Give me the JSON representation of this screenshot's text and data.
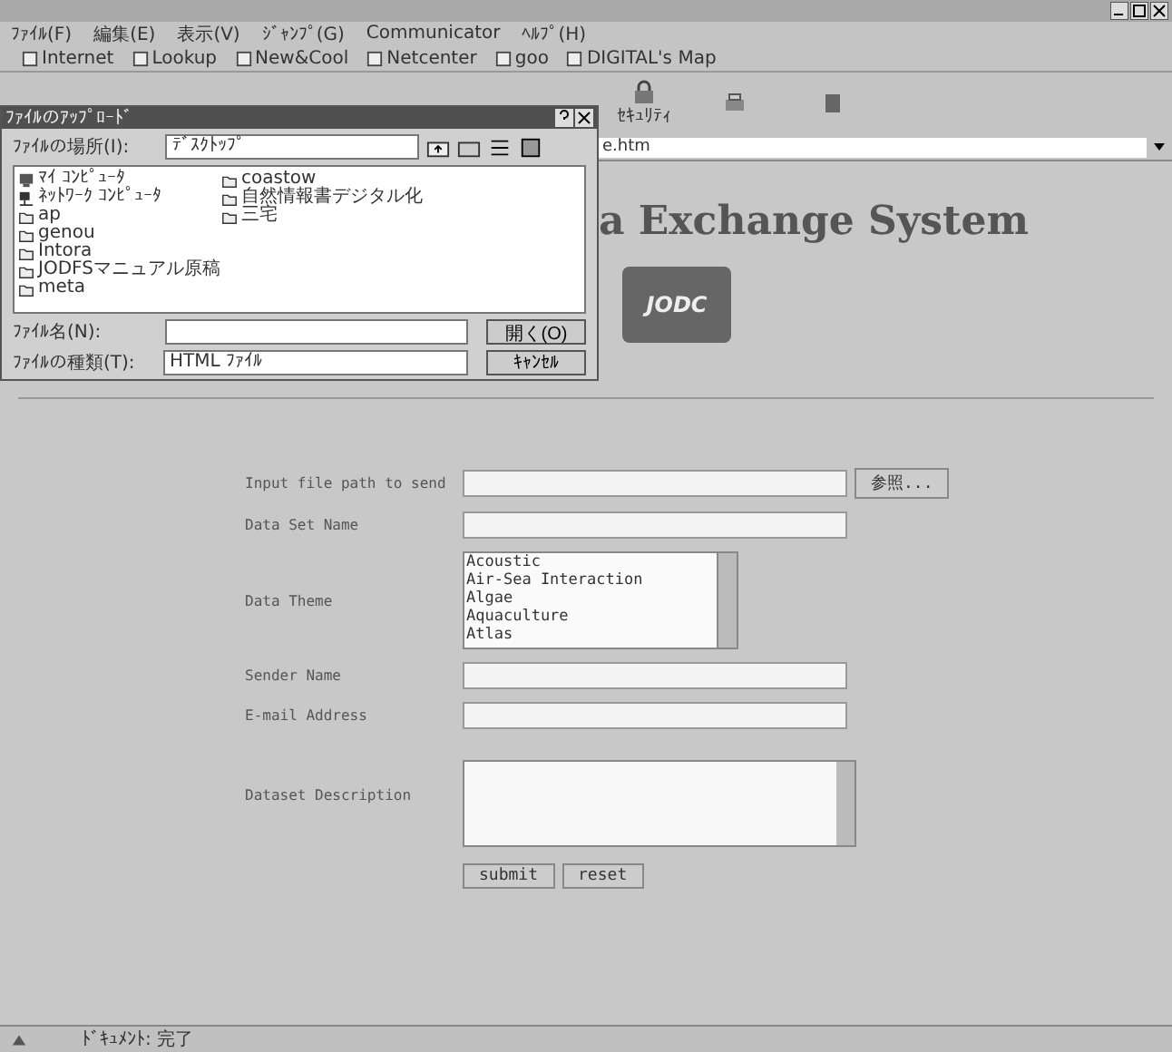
{
  "menu": [
    "ﾌｧｲﾙ(F)",
    "編集(E)",
    "表示(V)",
    "ｼﾞｬﾝﾌﾟ(G)",
    "Communicator",
    "ﾍﾙﾌﾟ(H)"
  ],
  "personal_toolbar": [
    "Internet",
    "Lookup",
    "New&Cool",
    "Netcenter",
    "goo",
    "DIGITAL's Map"
  ],
  "toolbar": [
    {
      "label": "ｾｷｭﾘﾃｨ"
    }
  ],
  "location": {
    "value": "e.htm"
  },
  "page": {
    "heading": "a Exchange System",
    "logo": "JODC"
  },
  "form": {
    "fields": [
      {
        "kind": "file",
        "label": "Input file path to send",
        "button": "参照..."
      },
      {
        "kind": "text",
        "label": "Data Set Name"
      },
      {
        "kind": "list",
        "label": "Data Theme",
        "options": [
          "Acoustic",
          "Air-Sea Interaction",
          "Algae",
          "Aquaculture",
          "Atlas"
        ]
      },
      {
        "kind": "text",
        "label": "Sender Name"
      },
      {
        "kind": "text",
        "label": "E-mail Address"
      },
      {
        "kind": "textarea",
        "label": "Dataset Description"
      }
    ],
    "buttons": [
      "submit",
      "reset"
    ]
  },
  "dialog": {
    "title": "ﾌｧｲﾙのｱｯﾌﾟﾛｰﾄﾞ",
    "look_in_label": "ﾌｧｲﾙの場所(I):",
    "look_in_value": "ﾃﾞｽｸﾄｯﾌﾟ",
    "files": [
      {
        "name": "ﾏｲ ｺﾝﾋﾟｭｰﾀ",
        "kind": "computer"
      },
      {
        "name": "ﾈｯﾄﾜｰｸ ｺﾝﾋﾟｭｰﾀ",
        "kind": "network"
      },
      {
        "name": "ap",
        "kind": "folder"
      },
      {
        "name": "genou",
        "kind": "folder"
      },
      {
        "name": "Intora",
        "kind": "folder"
      },
      {
        "name": "JODFSマニュアル原稿",
        "kind": "folder"
      },
      {
        "name": "meta",
        "kind": "folder"
      },
      {
        "name": "coastow",
        "kind": "folder"
      },
      {
        "name": "自然情報書デジタル化",
        "kind": "folder"
      },
      {
        "name": "三宅",
        "kind": "folder"
      }
    ],
    "file_name_label": "ﾌｧｲﾙ名(N):",
    "open_button": "開く(O)",
    "file_type_label": "ﾌｧｲﾙの種類(T):",
    "file_type_value": "HTML ﾌｧｲﾙ",
    "cancel_button": "ｷｬﾝｾﾙ"
  },
  "status_bar": "ﾄﾞｷｭﾒﾝﾄ: 完了"
}
